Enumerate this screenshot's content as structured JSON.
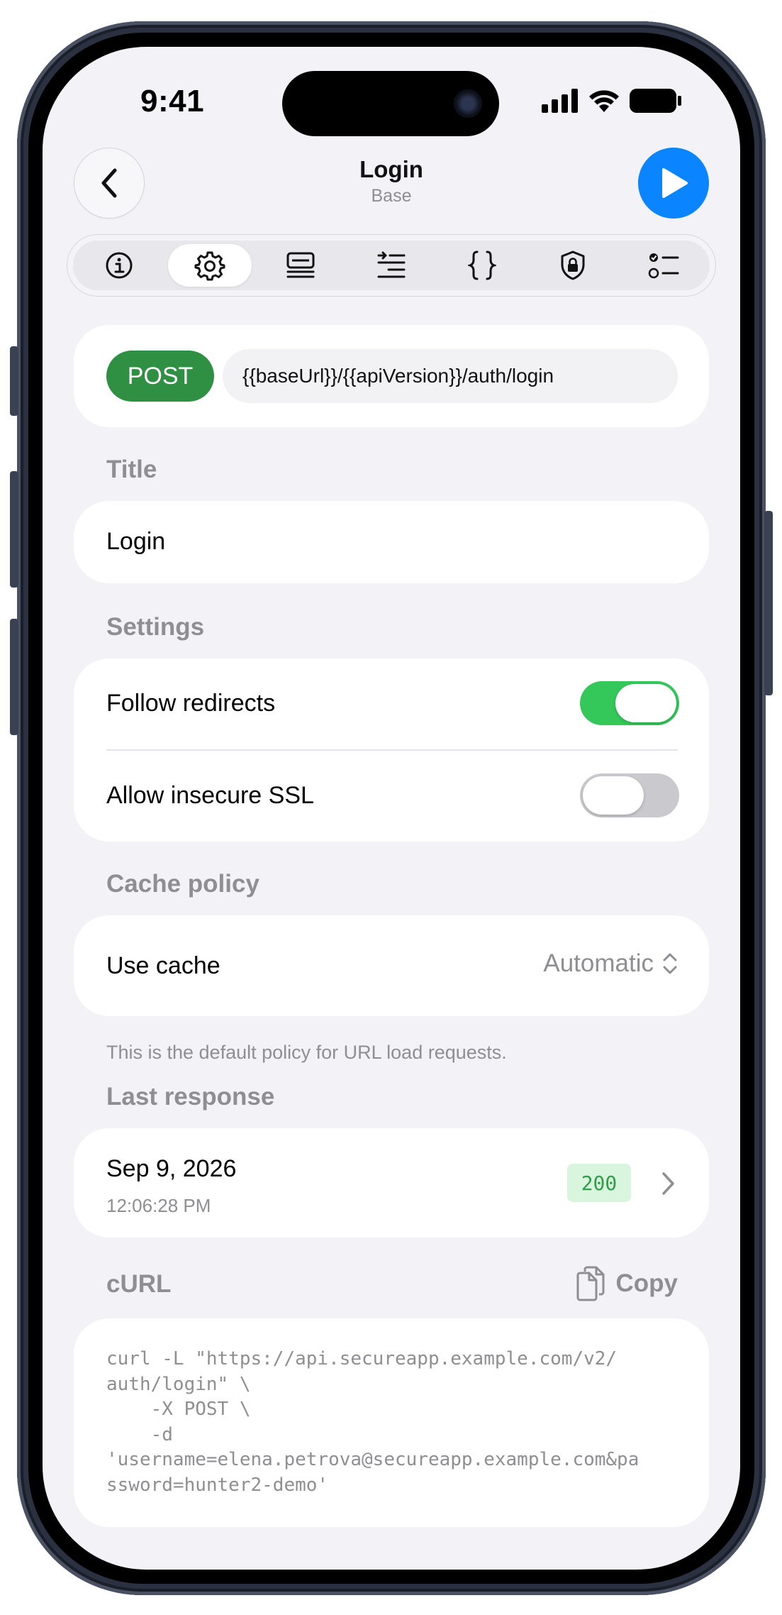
{
  "status_bar": {
    "time": "9:41"
  },
  "header": {
    "title": "Login",
    "subtitle": "Base"
  },
  "tabs": [
    {
      "icon": "info-icon",
      "active": false
    },
    {
      "icon": "gear-icon",
      "active": true
    },
    {
      "icon": "headers-list-icon",
      "active": false
    },
    {
      "icon": "params-icon",
      "active": false
    },
    {
      "icon": "braces-icon",
      "active": false
    },
    {
      "icon": "lock-shield-icon",
      "active": false
    },
    {
      "icon": "checklist-icon",
      "active": false
    }
  ],
  "request": {
    "method": "POST",
    "method_color": "#2f8f43",
    "url": "{{baseUrl}}/{{apiVersion}}/auth/login"
  },
  "title_section": {
    "label": "Title",
    "value": "Login"
  },
  "settings": {
    "label": "Settings",
    "follow_redirects": {
      "label": "Follow redirects",
      "enabled": true
    },
    "allow_insecure_ssl": {
      "label": "Allow insecure SSL",
      "enabled": false
    }
  },
  "cache_policy": {
    "label": "Cache policy",
    "row_label": "Use cache",
    "selected": "Automatic",
    "footnote": "This is the default policy for URL load requests."
  },
  "last_response": {
    "label": "Last response",
    "date": "Sep 9, 2026",
    "time": "12:06:28 PM",
    "status_code": "200",
    "status_color": "#2e9e49"
  },
  "curl": {
    "label": "cURL",
    "copy_label": "Copy",
    "command": "curl -L \"https://api.secureapp.example.com/v2/\nauth/login\" \\\n    -X POST \\\n    -d\n'username=elena.petrova@secureapp.example.com&pa\nssword=hunter2-demo'"
  },
  "colors": {
    "accent": "#0a84ff",
    "toggle_on": "#34c759",
    "background": "#f2f2f7"
  }
}
